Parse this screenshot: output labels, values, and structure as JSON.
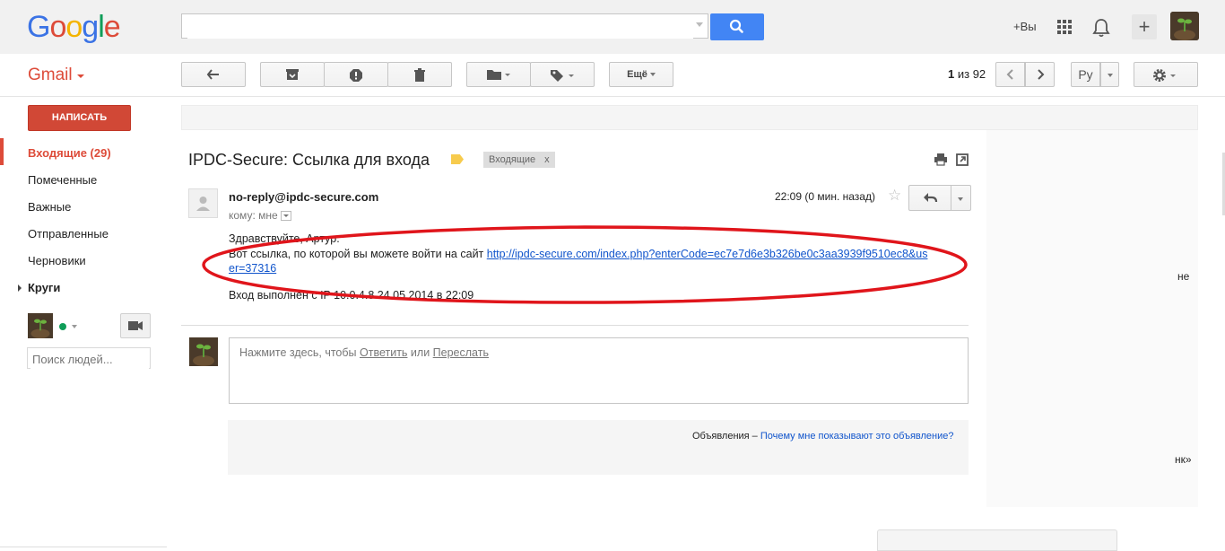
{
  "header": {
    "logo": "Google",
    "search_value": "",
    "plus_you": "+Вы"
  },
  "toolbar": {
    "app_label": "Gmail",
    "more_label": "Ещё",
    "pager_current": "1",
    "pager_sep": " из ",
    "pager_total": "92",
    "lang_label": "Ру"
  },
  "sidebar": {
    "compose_label": "НАПИСАТЬ",
    "items": [
      {
        "label": "Входящие (29)"
      },
      {
        "label": "Помеченные"
      },
      {
        "label": "Важные"
      },
      {
        "label": "Отправленные"
      },
      {
        "label": "Черновики"
      },
      {
        "label": "Круги"
      }
    ],
    "people_search_placeholder": "Поиск людей..."
  },
  "message": {
    "subject": "IPDC-Secure: Ссылка для входа",
    "label_chip": "Входящие",
    "label_chip_close": "x",
    "sender": "no-reply@ipdc-secure.com",
    "to_prefix": "кому: мне",
    "time": "22:09 (0 мин. назад)",
    "greeting": "Здравствуйте, Артур.",
    "link_intro": "Вот ссылка, по которой вы можете войти на сайт ",
    "link_url": "http://ipdc-secure.com/index.php?enterCode=ec7e7d6e3b326be0c3aa3939f9510ec8&user=37316",
    "login_info": "Вход выполнен с IP 10.0.4.8 24.05.2014 в 22:09"
  },
  "reply": {
    "prompt_prefix": "Нажмите здесь, чтобы ",
    "reply_link": "Ответить",
    "or_text": " или ",
    "forward_link": "Переслать"
  },
  "ads": {
    "label": "Объявления – ",
    "why_link": "Почему мне показывают это объявление?"
  },
  "right_fragments": {
    "frag1": "не",
    "frag2": "нк»"
  },
  "colors": {
    "accent_red": "#dd4b39",
    "search_blue": "#4285f4",
    "link_blue": "#1155cc",
    "annotation_red": "#e0151b"
  }
}
